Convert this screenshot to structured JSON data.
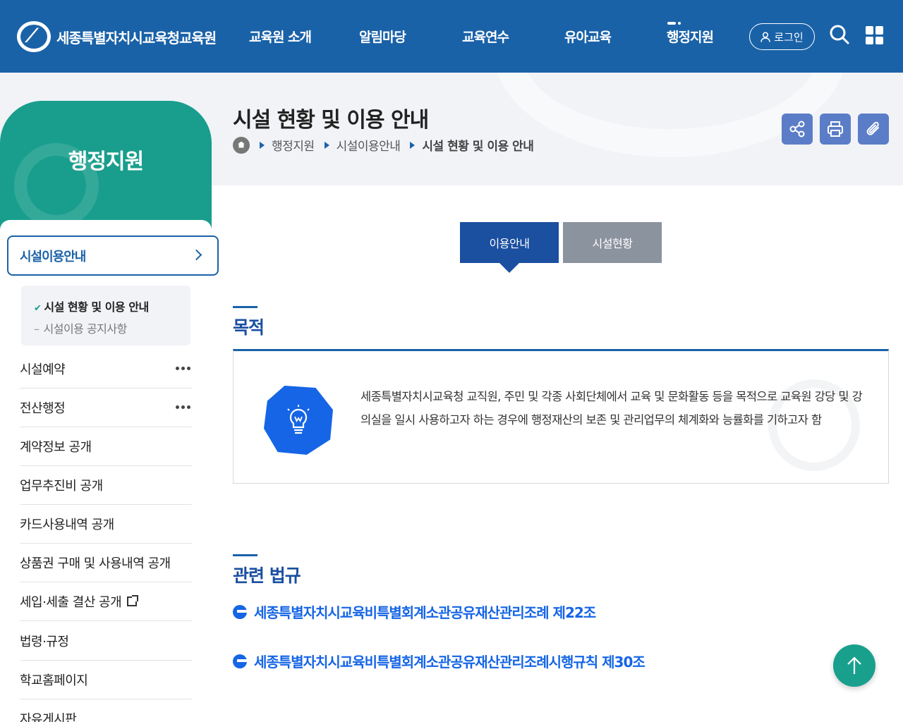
{
  "header": {
    "org_name": "세종특별자치시교육청교육원",
    "nav": [
      "교육원 소개",
      "알림마당",
      "교육연수",
      "유아교육",
      "행정지원"
    ],
    "login_label": "로그인"
  },
  "page": {
    "title": "시설 현황 및 이용 안내",
    "breadcrumb": [
      "행정지원",
      "시설이용안내",
      "시설 현황 및 이용 안내"
    ]
  },
  "sidebar": {
    "title": "행정지원",
    "active_menu": "시설이용안내",
    "submenu": {
      "current": "시설 현황 및 이용 안내",
      "other": "시설이용 공지사항"
    },
    "items": [
      {
        "label": "시설예약",
        "has_more": true
      },
      {
        "label": "전산행정",
        "has_more": true
      },
      {
        "label": "계약정보 공개"
      },
      {
        "label": "업무추진비 공개"
      },
      {
        "label": "카드사용내역 공개"
      },
      {
        "label": "상품권 구매 및 사용내역 공개"
      },
      {
        "label": "세입·세출 결산 공개",
        "external": true
      },
      {
        "label": "법령·규정"
      },
      {
        "label": "학교홈페이지"
      },
      {
        "label": "자유게시판"
      }
    ]
  },
  "tabs": [
    "이용안내",
    "시설현황"
  ],
  "purpose": {
    "heading": "목적",
    "text": "세종특별자치시교육청 교직원, 주민 및 각종 사회단체에서 교육 및 문화활동 등을 목적으로 교육원 강당 및 강의실을 일시 사용하고자 하는 경우에 행정재산의 보존 및 관리업무의 체계화와 능률화를 기하고자 함"
  },
  "laws": {
    "heading": "관련 법규",
    "links": [
      "세종특별자치시교육비특별회계소관공유재산관리조례 제22조",
      "세종특별자치시교육비특별회계소관공유재산관리조례시행규칙 제30조"
    ]
  },
  "colors": {
    "header_bg": "#1a62a8",
    "sidebar_accent": "#199e8d",
    "tab_active": "#1b4fa0",
    "link_blue": "#1565e6"
  }
}
